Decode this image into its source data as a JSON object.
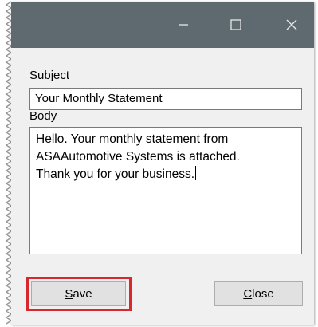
{
  "window": {
    "buttons": {
      "minimize_icon": "minimize-icon",
      "maximize_icon": "maximize-icon",
      "close_icon": "close-icon"
    }
  },
  "form": {
    "subject_label": "Subject",
    "subject_value": "Your Monthly Statement",
    "body_label": "Body",
    "body_value": "Hello. Your monthly statement from\nASAAutomotive Systems is attached.\nThank you for your business."
  },
  "footer": {
    "save_button": {
      "accelerator": "S",
      "rest": "ave"
    },
    "close_button": {
      "accelerator": "C",
      "rest": "lose"
    }
  },
  "colors": {
    "titlebar": "#5f6970",
    "dialog_bg": "#f0f0f0",
    "highlight": "#d9272e"
  }
}
